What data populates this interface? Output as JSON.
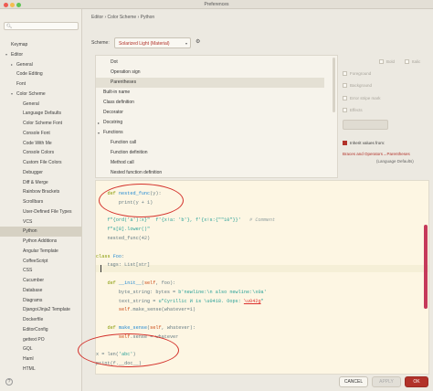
{
  "window": {
    "title": "Preferences"
  },
  "sidebar": {
    "items": [
      {
        "label": "Keymap",
        "indent": 1,
        "arrow": ""
      },
      {
        "label": "Editor",
        "indent": 1,
        "arrow": "down"
      },
      {
        "label": "General",
        "indent": 2,
        "arrow": "right"
      },
      {
        "label": "Code Editing",
        "indent": 2,
        "arrow": ""
      },
      {
        "label": "Font",
        "indent": 2,
        "arrow": ""
      },
      {
        "label": "Color Scheme",
        "indent": 2,
        "arrow": "down"
      },
      {
        "label": "General",
        "indent": 3,
        "arrow": ""
      },
      {
        "label": "Language Defaults",
        "indent": 3,
        "arrow": ""
      },
      {
        "label": "Color Scheme Font",
        "indent": 3,
        "arrow": ""
      },
      {
        "label": "Console Font",
        "indent": 3,
        "arrow": ""
      },
      {
        "label": "Code With Me",
        "indent": 3,
        "arrow": ""
      },
      {
        "label": "Console Colors",
        "indent": 3,
        "arrow": ""
      },
      {
        "label": "Custom File Colors",
        "indent": 3,
        "arrow": ""
      },
      {
        "label": "Debugger",
        "indent": 3,
        "arrow": ""
      },
      {
        "label": "Diff & Merge",
        "indent": 3,
        "arrow": ""
      },
      {
        "label": "Rainbow Brackets",
        "indent": 3,
        "arrow": ""
      },
      {
        "label": "Scrollbars",
        "indent": 3,
        "arrow": ""
      },
      {
        "label": "User-Defined File Types",
        "indent": 3,
        "arrow": ""
      },
      {
        "label": "VCS",
        "indent": 3,
        "arrow": ""
      },
      {
        "label": "Python",
        "indent": 3,
        "arrow": "",
        "selected": true
      },
      {
        "label": "Python Additions",
        "indent": 3,
        "arrow": ""
      },
      {
        "label": "Angular Template",
        "indent": 3,
        "arrow": ""
      },
      {
        "label": "CoffeeScript",
        "indent": 3,
        "arrow": ""
      },
      {
        "label": "CSS",
        "indent": 3,
        "arrow": ""
      },
      {
        "label": "Cucumber",
        "indent": 3,
        "arrow": ""
      },
      {
        "label": "Database",
        "indent": 3,
        "arrow": ""
      },
      {
        "label": "Diagrams",
        "indent": 3,
        "arrow": ""
      },
      {
        "label": "Django/Jinja2 Template",
        "indent": 3,
        "arrow": ""
      },
      {
        "label": "Dockerfile",
        "indent": 3,
        "arrow": ""
      },
      {
        "label": "EditorConfig",
        "indent": 3,
        "arrow": ""
      },
      {
        "label": "gettext PO",
        "indent": 3,
        "arrow": ""
      },
      {
        "label": "GQL",
        "indent": 3,
        "arrow": ""
      },
      {
        "label": "Haml",
        "indent": 3,
        "arrow": ""
      },
      {
        "label": "HTML",
        "indent": 3,
        "arrow": ""
      }
    ]
  },
  "breadcrumb": "Editor › Color Scheme › Python",
  "scheme": {
    "label": "Scheme:",
    "value": "Solarized Light (Material)"
  },
  "elements": [
    {
      "label": "Dot",
      "indent": 2,
      "arrow": ""
    },
    {
      "label": "Operation sign",
      "indent": 2,
      "arrow": ""
    },
    {
      "label": "Parentheses",
      "indent": 2,
      "arrow": "",
      "selected": true
    },
    {
      "label": "Built-in name",
      "indent": 1,
      "arrow": ""
    },
    {
      "label": "Class definition",
      "indent": 1,
      "arrow": ""
    },
    {
      "label": "Decorator",
      "indent": 1,
      "arrow": ""
    },
    {
      "label": "Docstring",
      "indent": 1,
      "arrow": "right"
    },
    {
      "label": "Functions",
      "indent": 1,
      "arrow": "down"
    },
    {
      "label": "Function call",
      "indent": 2,
      "arrow": ""
    },
    {
      "label": "Function definition",
      "indent": 2,
      "arrow": ""
    },
    {
      "label": "Method call",
      "indent": 2,
      "arrow": ""
    },
    {
      "label": "Nested function definition",
      "indent": 2,
      "arrow": ""
    }
  ],
  "attributes": {
    "bold": "Bold",
    "italic": "Italic",
    "foreground": "Foreground",
    "background": "Background",
    "error_stripe": "Error stripe mark",
    "effects": "Effects",
    "inherit_label": "Inherit values from:",
    "inherit_link": "Braces and Operators→Parentheses",
    "inherit_sub": "(Language Defaults)"
  },
  "code_lines": [
    [
      [
        "    def ",
        "kw"
      ],
      [
        "nested_func",
        "fn"
      ],
      [
        "(y):",
        ""
      ]
    ],
    [
      [
        "        print(y + 1)",
        ""
      ]
    ],
    [
      [
        "",
        ""
      ]
    ],
    [
      [
        "    ",
        ""
      ],
      [
        "f\"{ord('a'):x}\"",
        "str"
      ],
      [
        "  ",
        ""
      ],
      [
        "f'{x!a: 'b'}, f'{x!s:{\"\"10\"}}'",
        "str"
      ],
      [
        "   ",
        ""
      ],
      [
        "# Comment",
        "cm"
      ]
    ],
    [
      [
        "    f\"s[8].lower()\"",
        "str"
      ]
    ],
    [
      [
        "    nested_func(42)",
        ""
      ]
    ],
    [
      [
        "",
        ""
      ]
    ],
    [
      [
        "class ",
        "kw"
      ],
      [
        "Foo",
        "fn"
      ],
      [
        ":",
        ""
      ]
    ],
    [
      [
        "    tags: List[str]",
        ""
      ]
    ],
    [
      [
        "",
        ""
      ]
    ],
    [
      [
        "    ",
        ""
      ],
      [
        "def ",
        "kw"
      ],
      [
        "__init__",
        "fn"
      ],
      [
        "(",
        ""
      ],
      [
        "self",
        "sf"
      ],
      [
        ", foo):",
        ""
      ]
    ],
    [
      [
        "        byte_string: bytes = ",
        ""
      ],
      [
        "b'newline:\\n also newline:\\x0a'",
        "str"
      ]
    ],
    [
      [
        "        text_string = ",
        ""
      ],
      [
        "u\"Cyrillic И is \\u0418. Oops: ",
        "str"
      ],
      [
        "\\u042g",
        "esc"
      ],
      [
        "\"",
        "str"
      ]
    ],
    [
      [
        "        ",
        ""
      ],
      [
        "self",
        "sf"
      ],
      [
        ".make_sense(whatever=1)",
        ""
      ]
    ],
    [
      [
        "",
        ""
      ]
    ],
    [
      [
        "    ",
        ""
      ],
      [
        "def ",
        "kw"
      ],
      [
        "make_sense",
        "fn"
      ],
      [
        "(",
        ""
      ],
      [
        "self",
        "sf"
      ],
      [
        ", whatever):",
        ""
      ]
    ],
    [
      [
        "        ",
        ""
      ],
      [
        "self",
        "sf"
      ],
      [
        ".sense = whatever",
        ""
      ]
    ],
    [
      [
        "",
        ""
      ]
    ],
    [
      [
        "x = len(",
        ""
      ],
      [
        "'abc'",
        "str"
      ],
      [
        ")",
        ""
      ]
    ],
    [
      [
        "print(f.__doc__)",
        ""
      ]
    ]
  ],
  "buttons": {
    "cancel": "CANCEL",
    "apply": "APPLY",
    "ok": "OK",
    "help": "?"
  }
}
